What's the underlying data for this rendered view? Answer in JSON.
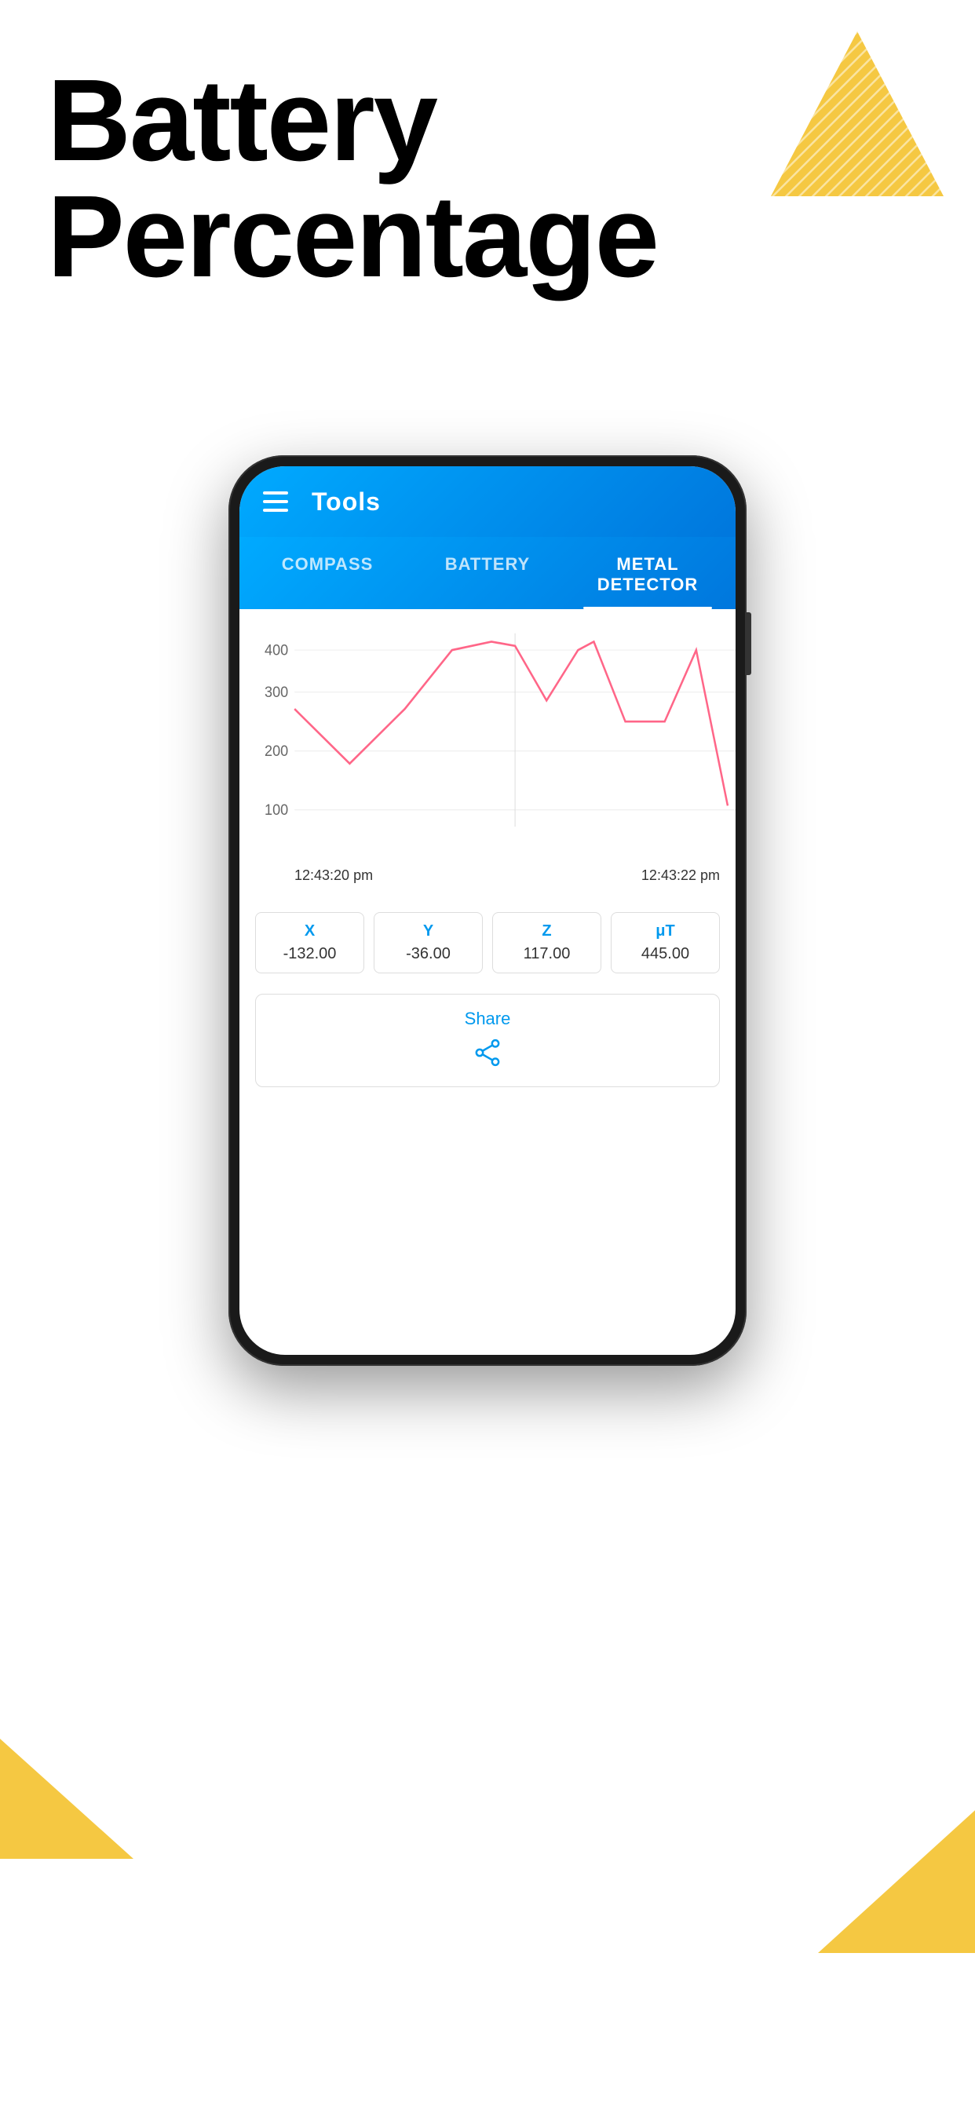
{
  "page": {
    "background": "#ffffff"
  },
  "title": {
    "line1": "Battery",
    "line2": "Percentage"
  },
  "app": {
    "header": {
      "title": "Tools"
    },
    "tabs": [
      {
        "label": "COMPASS",
        "active": false
      },
      {
        "label": "BATTERY",
        "active": false
      },
      {
        "label": "METAL DETECTOR",
        "active": true
      }
    ],
    "chart": {
      "yAxis": [
        400,
        300,
        200,
        100
      ],
      "timestamps": [
        "12:43:20 pm",
        "12:43:22 pm"
      ],
      "lineColor": "#FF6688"
    },
    "sensors": [
      {
        "label": "X",
        "value": "-132.00"
      },
      {
        "label": "Y",
        "value": "-36.00"
      },
      {
        "label": "Z",
        "value": "117.00"
      },
      {
        "label": "μT",
        "value": "445.00"
      }
    ],
    "share": {
      "label": "Share"
    }
  },
  "colors": {
    "accent": "#F5C842",
    "primary": "#0099EE",
    "headerGrad1": "#00AAFF",
    "headerGrad2": "#0077DD"
  }
}
